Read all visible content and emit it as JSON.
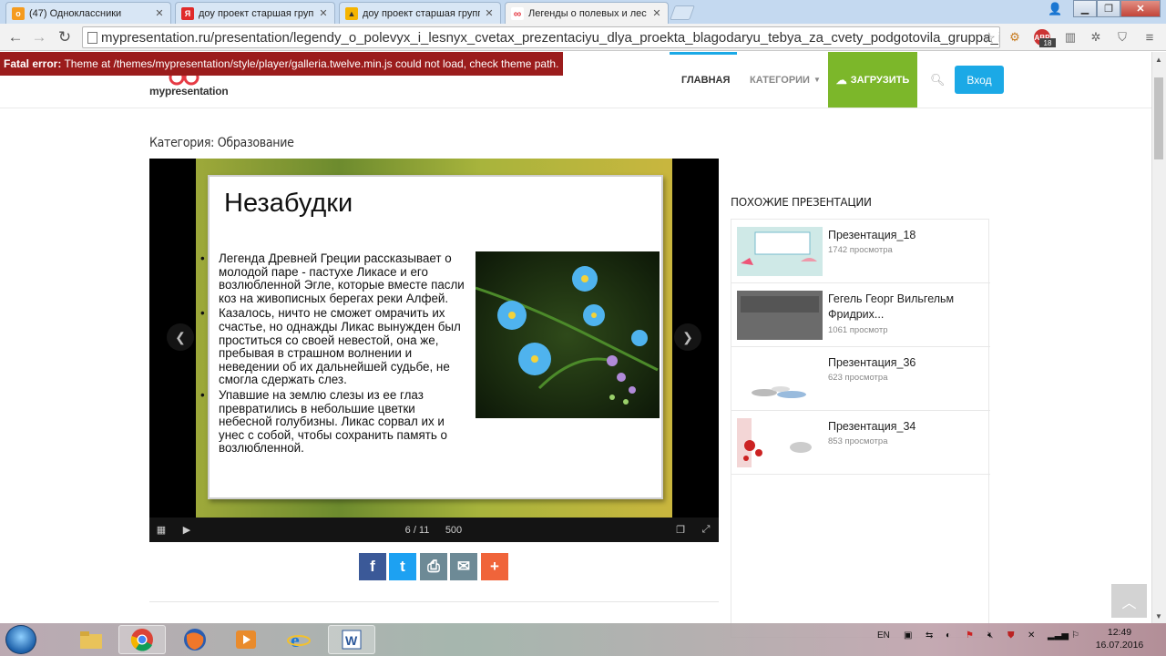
{
  "browser": {
    "tabs": [
      {
        "title": "(47) Одноклассники",
        "favicon": "odnoklassniki-icon",
        "color": "#f59b1e",
        "glyph": "o"
      },
      {
        "title": "доу проект старшая групп",
        "favicon": "yandex-icon",
        "color": "#e02a2a",
        "glyph": "Я"
      },
      {
        "title": "доу проект старшая групп",
        "favicon": "yandex-images-icon",
        "color": "#f5b400",
        "glyph": "▲"
      },
      {
        "title": "Легенды о полевых и лес",
        "favicon": "mypresentation-icon",
        "color": "#e63a44",
        "glyph": "∞"
      }
    ],
    "url": "mypresentation.ru/presentation/legendy_o_polevyx_i_lesnyx_cvetax_prezentaciyu_dlya_proekta_blagodaryu_tebya_za_cvety_podgotovila_gruppa_i",
    "abp_count": "18"
  },
  "error": {
    "label": "Fatal error:",
    "message": " Theme at /themes/mypresentation/style/player/galleria.twelve.min.js could not load, check theme path."
  },
  "site": {
    "logo": "mypresentation",
    "nav": {
      "home": "ГЛАВНАЯ",
      "categories": "КАТЕГОРИИ",
      "upload": "ЗАГРУЗИТЬ",
      "login": "Вход"
    },
    "brand_color": "#1ba9e6",
    "upload_color": "#7cb72a"
  },
  "main": {
    "category": "Категория: Образование",
    "slide": {
      "title": "Незабудки",
      "bullets": [
        "Легенда Древней Греции рассказывает о молодой паре - пастухе Ликасе и его возлюбленной Эгле, которые вместе пасли коз на живописных берегах реки Алфей.",
        "Казалось, ничто не сможет омрачить их счастье, но однажды Ликас вынужден был проститься со своей невестой, она же, пребывая в страшном волнении и неведении об их дальнейшей судьбе, не смогла сдержать слез.",
        "Упавшие на землю слезы из ее глаз превратились в небольшие цветки небесной голубизны. Ликас сорвал их и унес с собой, чтобы сохранить память о возлюбленной."
      ]
    },
    "player": {
      "counter": "6 / 11",
      "size": "500"
    },
    "share": [
      {
        "name": "facebook",
        "glyph": "f",
        "color": "#3b5998"
      },
      {
        "name": "twitter",
        "glyph": "t",
        "color": "#1da1f2"
      },
      {
        "name": "print",
        "glyph": "⎙",
        "color": "#6d8a96"
      },
      {
        "name": "email",
        "glyph": "✉",
        "color": "#6d8a96"
      },
      {
        "name": "more",
        "glyph": "+",
        "color": "#f0643a"
      }
    ]
  },
  "sidebar": {
    "title": "ПОХОЖИЕ ПРЕЗЕНТАЦИИ",
    "items": [
      {
        "title": "Презентация_18",
        "views": "1742 просмотра"
      },
      {
        "title": "Гегель Георг Вильгельм Фридрих...",
        "views": "1061 просмотр"
      },
      {
        "title": "Презентация_36",
        "views": "623 просмотра"
      },
      {
        "title": "Презентация_34",
        "views": "853 просмотра"
      }
    ]
  },
  "taskbar": {
    "lang": "EN",
    "time": "12:49",
    "date": "16.07.2016"
  }
}
